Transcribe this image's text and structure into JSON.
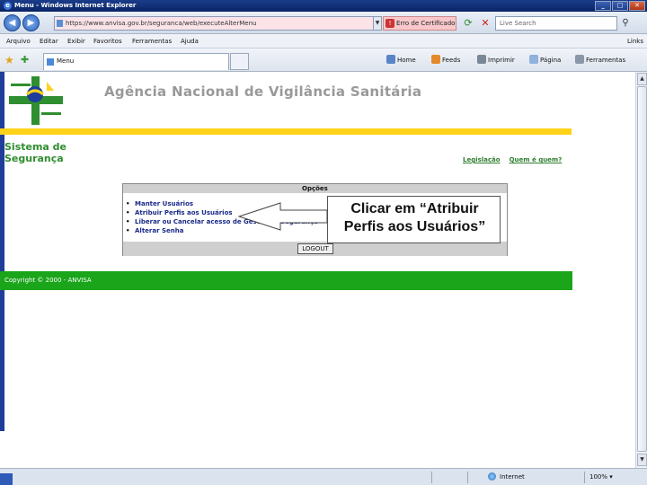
{
  "window": {
    "title": "Menu - Windows Internet Explorer"
  },
  "address_bar": {
    "url": "https://www.anvisa.gov.br/seguranca/web/executeAlterMenu",
    "cert_label": "Erro de Certificado",
    "search_placeholder": "Live Search"
  },
  "menu": {
    "items": [
      "Arquivo",
      "Editar",
      "Exibir",
      "Favoritos",
      "Ferramentas",
      "Ajuda"
    ],
    "links_label": "Links"
  },
  "command_bar": {
    "tab_title": "Menu",
    "items": [
      "Home",
      "Feeds",
      "Imprimir",
      "Página",
      "Ferramentas"
    ]
  },
  "page": {
    "site_title": "Agência Nacional de Vigilância Sanitária",
    "system_title_line1": "Sistema de",
    "system_title_line2": "Segurança",
    "top_links": [
      "Legislação",
      "Quem é quem?"
    ],
    "options_header": "Opções",
    "options": [
      "Manter Usuários",
      "Atribuir Perfis aos Usuários",
      "Liberar ou Cancelar acesso de Gestor de Segurança",
      "Alterar Senha"
    ],
    "logout_label": "LOGOUT",
    "copyright": "Copyright © 2000 - ANVISA",
    "callout_line1": "Clicar em “Atribuir",
    "callout_line2": "Perfis aos Usuários”"
  },
  "status_bar": {
    "zone": "Internet",
    "zoom": "100%"
  },
  "colors": {
    "brand_green": "#2f8e2f",
    "brand_yellow": "#ffd21a",
    "footer_green": "#1aa51a"
  }
}
